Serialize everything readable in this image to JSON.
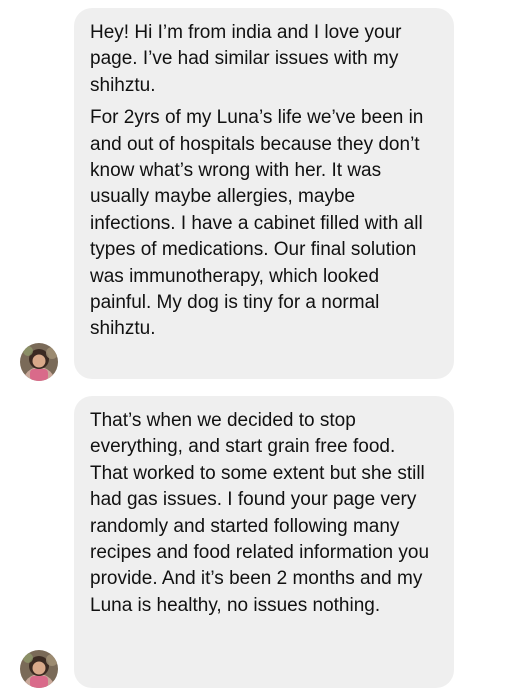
{
  "conversation": {
    "messages": [
      {
        "paragraphs": [
          "Hey! Hi I’m from india and I love your page. I’ve had similar issues with my shihztu.",
          "For 2yrs of my Luna’s life we’ve been in and out of hospitals because they don’t know what’s wrong with her. It was usually maybe allergies, maybe infections. I have a cabinet filled with all types of medications. Our final solution was immunotherapy, which looked painful. My dog is tiny for a normal shihztu."
        ]
      },
      {
        "paragraphs": [
          "That’s when we decided to stop everything, and start grain free food. That worked to some extent but she still had gas issues. I found your page very randomly and started following many recipes and food related information you provide. And it’s been 2 months and my Luna is healthy, no issues nothing."
        ]
      }
    ]
  }
}
